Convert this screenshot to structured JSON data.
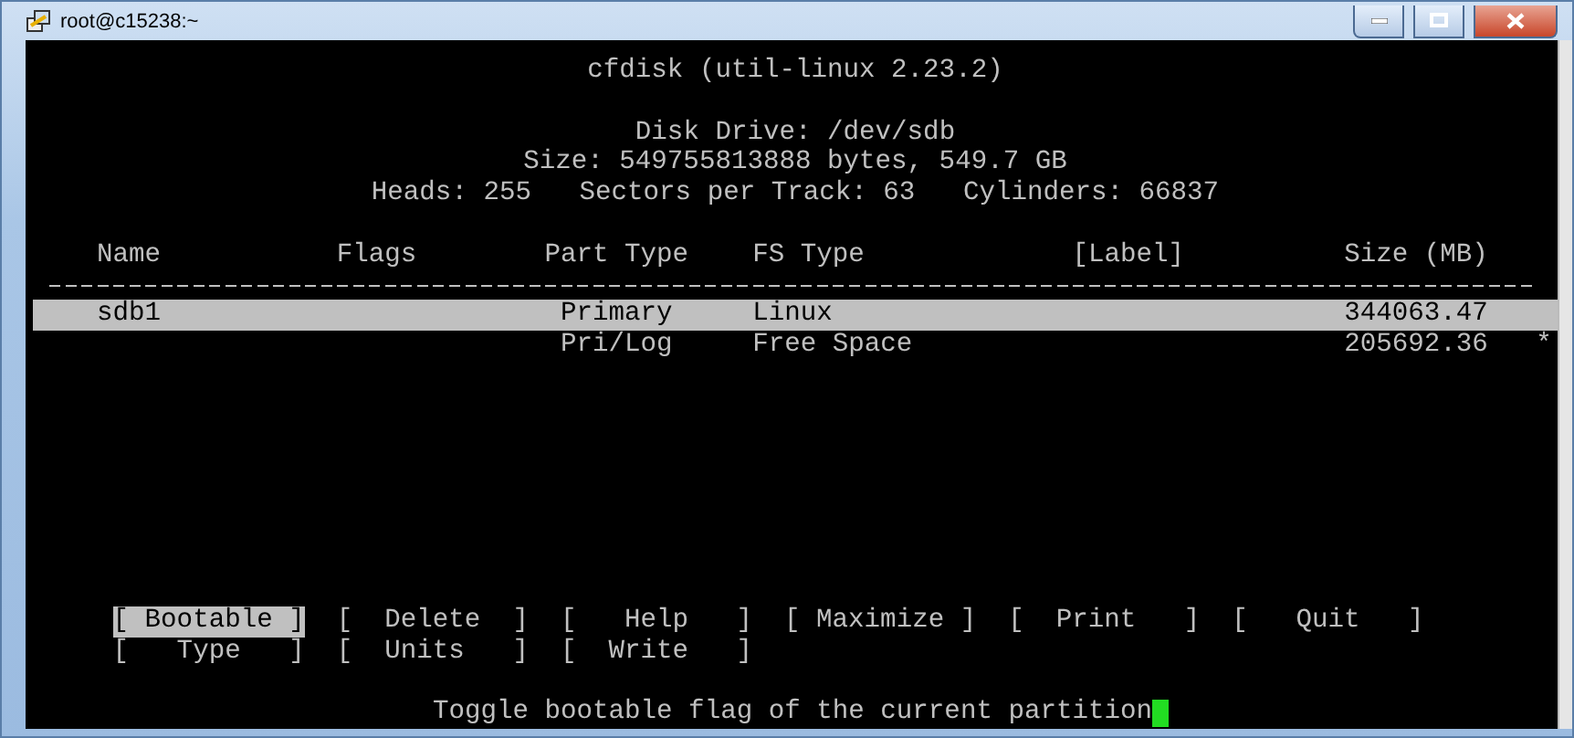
{
  "window": {
    "title": "root@c15238:~"
  },
  "terminal": {
    "title": "cfdisk (util-linux 2.23.2)",
    "disk_info": [
      "Disk Drive: /dev/sdb",
      "Size: 549755813888 bytes, 549.7 GB",
      "Heads: 255   Sectors per Track: 63   Cylinders: 66837"
    ],
    "table": {
      "columns": [
        "Name",
        "Flags",
        "Part Type",
        "FS Type",
        "[Label]",
        "Size (MB)"
      ],
      "rows": [
        {
          "cells": [
            "sdb1",
            "",
            "Primary",
            "Linux",
            "",
            "344063.47"
          ],
          "marker": "",
          "selected": true
        },
        {
          "cells": [
            "",
            "",
            "Pri/Log",
            "Free Space",
            "",
            "205692.36"
          ],
          "marker": "*",
          "selected": false
        }
      ]
    },
    "buttons": [
      [
        {
          "label": "[ Bootable ]",
          "selected": true
        },
        {
          "label": "[  Delete  ]",
          "selected": false
        },
        {
          "label": "[   Help   ]",
          "selected": false
        },
        {
          "label": "[ Maximize ]",
          "selected": false
        },
        {
          "label": "[  Print   ]",
          "selected": false
        },
        {
          "label": "[   Quit   ]",
          "selected": false
        }
      ],
      [
        {
          "label": "[   Type   ]",
          "selected": false
        },
        {
          "label": "[  Units   ]",
          "selected": false
        },
        {
          "label": "[  Write   ]",
          "selected": false
        }
      ]
    ],
    "status": "Toggle bootable flag of the current partition"
  }
}
